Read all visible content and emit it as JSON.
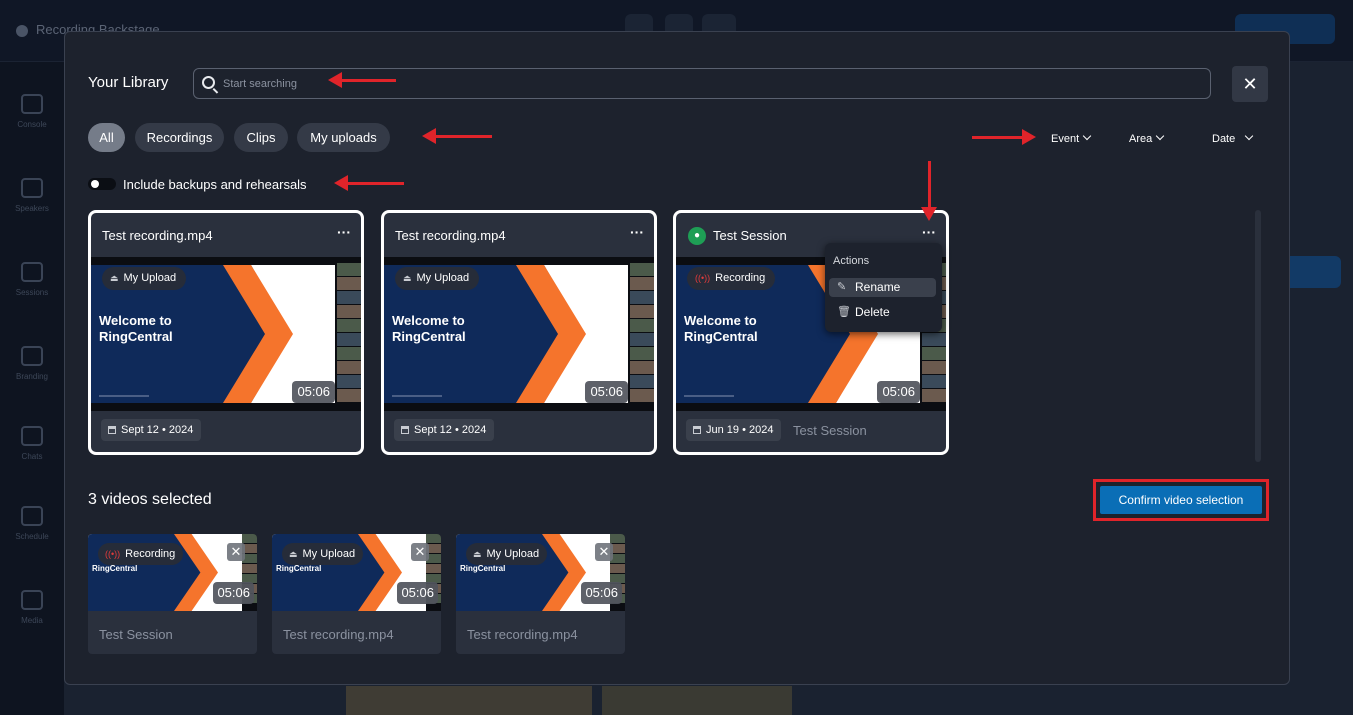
{
  "background": {
    "app_name": "Recording Backstage",
    "sidebar": [
      "Console",
      "Speakers",
      "Sessions",
      "Branding",
      "Chats",
      "Schedule",
      "Media"
    ]
  },
  "modal": {
    "title": "Your Library",
    "search_placeholder": "Start searching",
    "close_icon": "close-icon",
    "tabs": [
      {
        "label": "All",
        "active": true
      },
      {
        "label": "Recordings",
        "active": false
      },
      {
        "label": "Clips",
        "active": false
      },
      {
        "label": "My uploads",
        "active": false
      }
    ],
    "filters": [
      {
        "label": "Event"
      },
      {
        "label": "Area"
      },
      {
        "label": "Date"
      }
    ],
    "toggle_label": "Include backups and rehearsals",
    "toggle_on": false,
    "slide_text_line1": "Welcome to",
    "slide_text_line2": "RingCentral",
    "cards": [
      {
        "title": "Test recording.mp4",
        "badge": "My Upload",
        "badge_icon": "upload-icon",
        "duration": "05:06",
        "date": "Sept 12 • 2024",
        "session": ""
      },
      {
        "title": "Test recording.mp4",
        "badge": "My Upload",
        "badge_icon": "upload-icon",
        "duration": "05:06",
        "date": "Sept 12 • 2024",
        "session": ""
      },
      {
        "title": "Test Session",
        "badge": "Recording",
        "badge_icon": "recording-icon",
        "duration": "05:06",
        "date": "Jun 19 • 2024",
        "session": "Test Session"
      }
    ],
    "actions_menu": {
      "heading": "Actions",
      "items": [
        {
          "label": "Rename",
          "icon": "edit-icon"
        },
        {
          "label": "Delete",
          "icon": "trash-icon"
        }
      ]
    },
    "selected_title": "3 videos selected",
    "confirm_label": "Confirm video selection",
    "selected": [
      {
        "name": "Test Session",
        "badge": "Recording",
        "duration": "05:06"
      },
      {
        "name": "Test recording.mp4",
        "badge": "My Upload",
        "duration": "05:06"
      },
      {
        "name": "Test recording.mp4",
        "badge": "My Upload",
        "duration": "05:06"
      }
    ],
    "selected_slide_text": "RingCentral",
    "more_glyph": "···",
    "remove_glyph": "✕"
  },
  "colors": {
    "accent": "#0a6eb6",
    "annotation": "#e0242a",
    "navy": "#0f2a5a",
    "orange": "#f5742c"
  }
}
